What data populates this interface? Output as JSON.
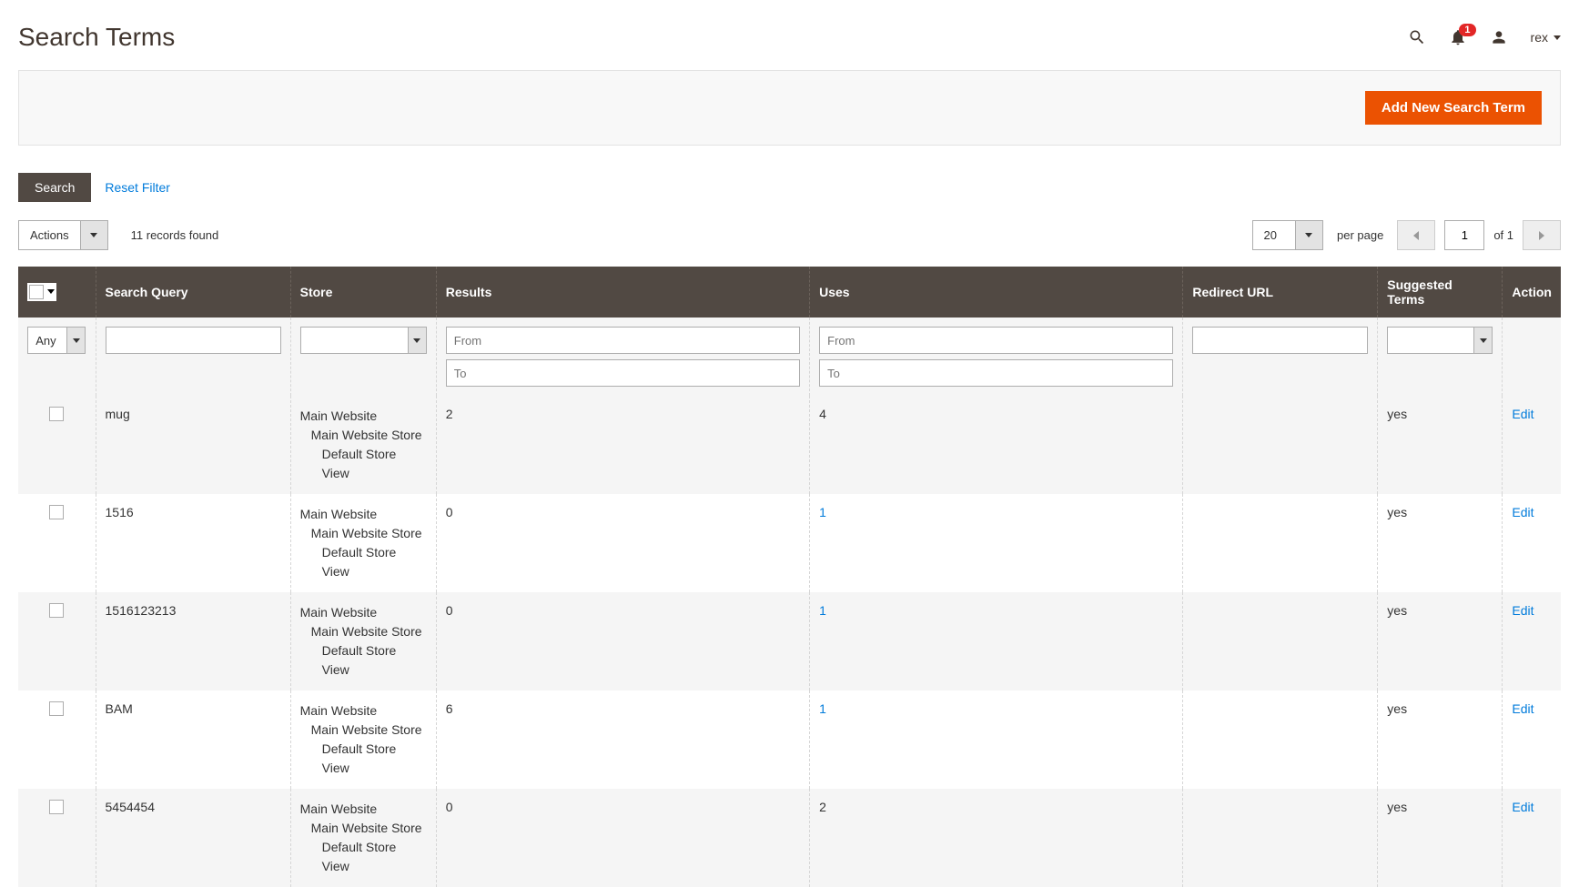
{
  "header": {
    "title": "Search Terms",
    "notification_count": "1",
    "username": "rex"
  },
  "toolbar": {
    "add_button": "Add New Search Term"
  },
  "filters": {
    "search_button": "Search",
    "reset_link": "Reset Filter"
  },
  "grid_controls": {
    "actions_label": "Actions",
    "records_found": "11 records found",
    "per_page_value": "20",
    "per_page_label": "per page",
    "page_value": "1",
    "page_total": "of 1"
  },
  "columns": {
    "search_query": "Search Query",
    "store": "Store",
    "results": "Results",
    "uses": "Uses",
    "redirect_url": "Redirect URL",
    "suggested_terms": "Suggested Terms",
    "action": "Action"
  },
  "filter_row": {
    "any_value": "Any",
    "from_placeholder": "From",
    "to_placeholder": "To"
  },
  "rows": [
    {
      "query": "mug",
      "store_l1": "Main Website",
      "store_l2": "Main Website Store",
      "store_l3": "Default Store View",
      "results": "2",
      "uses": "4",
      "uses_link": false,
      "redirect": "",
      "suggested": "yes",
      "action": "Edit"
    },
    {
      "query": "1516",
      "store_l1": "Main Website",
      "store_l2": "Main Website Store",
      "store_l3": "Default Store View",
      "results": "0",
      "uses": "1",
      "uses_link": true,
      "redirect": "",
      "suggested": "yes",
      "action": "Edit"
    },
    {
      "query": "1516123213",
      "store_l1": "Main Website",
      "store_l2": "Main Website Store",
      "store_l3": "Default Store View",
      "results": "0",
      "uses": "1",
      "uses_link": true,
      "redirect": "",
      "suggested": "yes",
      "action": "Edit"
    },
    {
      "query": "BAM",
      "store_l1": "Main Website",
      "store_l2": "Main Website Store",
      "store_l3": "Default Store View",
      "results": "6",
      "uses": "1",
      "uses_link": true,
      "redirect": "",
      "suggested": "yes",
      "action": "Edit"
    },
    {
      "query": "5454454",
      "store_l1": "Main Website",
      "store_l2": "Main Website Store",
      "store_l3": "Default Store View",
      "results": "0",
      "uses": "2",
      "uses_link": false,
      "redirect": "",
      "suggested": "yes",
      "action": "Edit"
    }
  ]
}
